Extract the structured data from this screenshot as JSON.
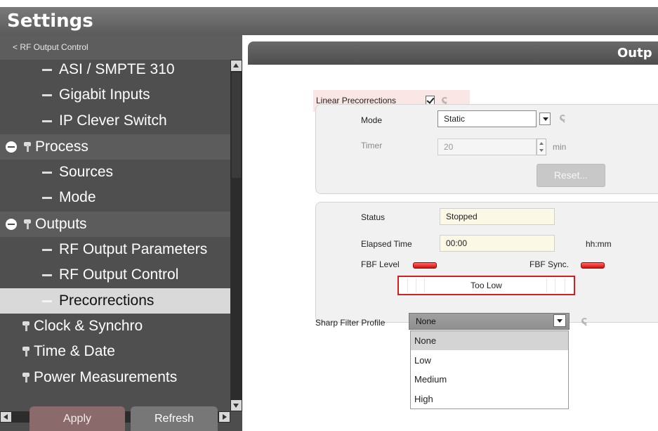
{
  "app": {
    "title": "Settings"
  },
  "sidebar": {
    "back_label": "< RF Output Control",
    "items": [
      {
        "label": "ASI / SMPTE 310",
        "level": 1
      },
      {
        "label": "Gigabit Inputs",
        "level": 1
      },
      {
        "label": "IP Clever Switch",
        "level": 1
      },
      {
        "label": "Process",
        "level": 0,
        "expanded": true
      },
      {
        "label": "Sources",
        "level": 1
      },
      {
        "label": "Mode",
        "level": 1
      },
      {
        "label": "Outputs",
        "level": 0,
        "expanded": true
      },
      {
        "label": "RF Output Parameters",
        "level": 1
      },
      {
        "label": "RF Output Control",
        "level": 1
      },
      {
        "label": "Precorrections",
        "level": 1,
        "selected": true
      },
      {
        "label": "Clock & Synchro",
        "level": 0
      },
      {
        "label": "Time & Date",
        "level": 0
      },
      {
        "label": "Power Measurements",
        "level": 0
      }
    ],
    "apply_label": "Apply",
    "refresh_label": "Refresh"
  },
  "content": {
    "section_title": "Outp",
    "linear_precorrections": {
      "label": "Linear Precorrections",
      "checked": true
    },
    "mode_panel": {
      "mode_label": "Mode",
      "mode_value": "Static",
      "timer_label": "Timer",
      "timer_value": "20",
      "timer_unit": "min",
      "reset_label": "Reset..."
    },
    "status_panel": {
      "status_label": "Status",
      "status_value": "Stopped",
      "elapsed_label": "Elapsed Time",
      "elapsed_value": "00:00",
      "elapsed_unit": "hh:mm",
      "fbf_level_label": "FBF Level",
      "fbf_sync_label": "FBF Sync.",
      "level_text": "Too Low"
    },
    "sharp_filter": {
      "label": "Sharp Filter Profile",
      "value": "None",
      "options": [
        "None",
        "Low",
        "Medium",
        "High"
      ]
    }
  },
  "colors": {
    "led_red": "#e01515",
    "alert_border": "#d21f1f",
    "highlight_pink": "#fbe6e6"
  }
}
